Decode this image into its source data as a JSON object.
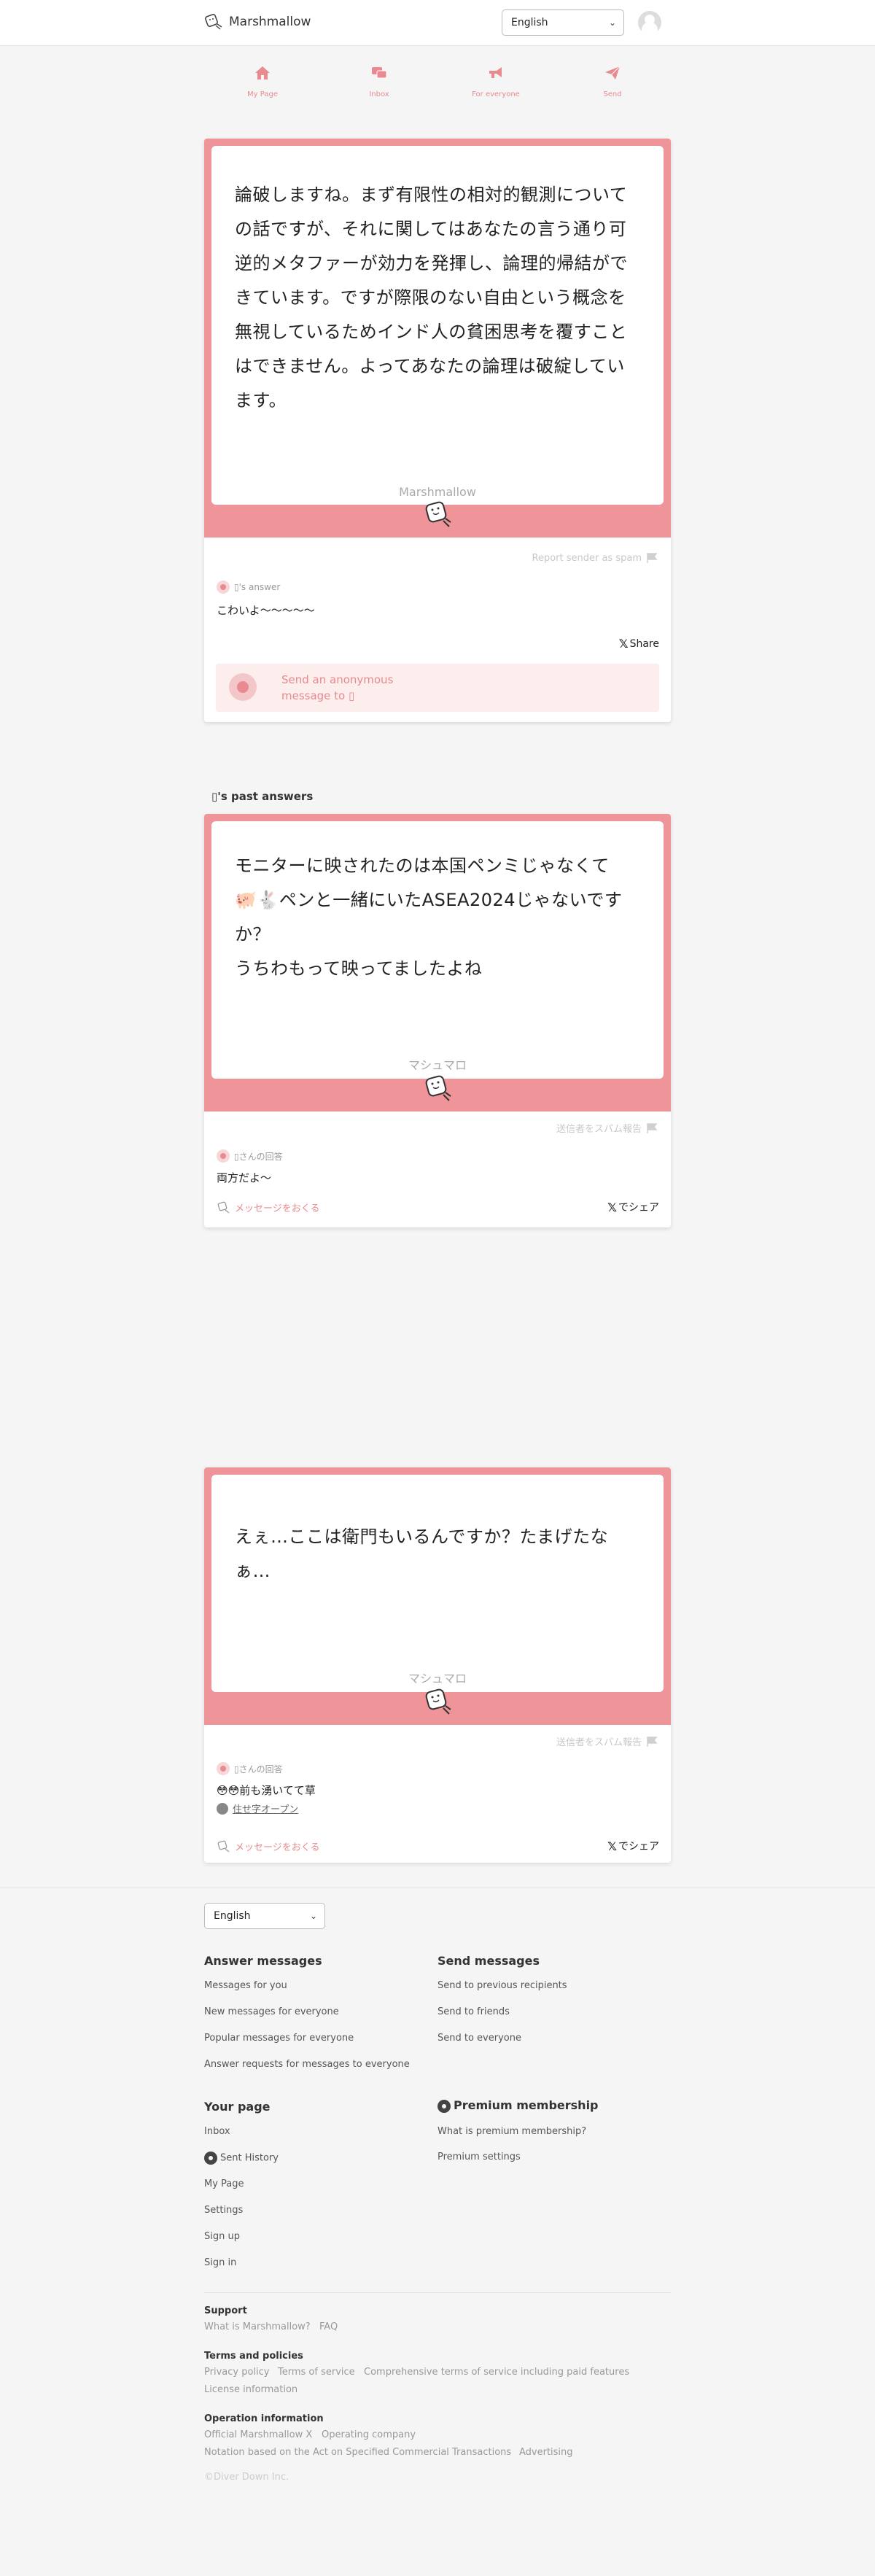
{
  "header": {
    "brand": "Marshmallow",
    "language": "English"
  },
  "nav": [
    {
      "label": "My Page",
      "icon": "home-icon"
    },
    {
      "label": "Inbox",
      "icon": "inbox-icon"
    },
    {
      "label": "For everyone",
      "icon": "megaphone-icon"
    },
    {
      "label": "Send",
      "icon": "paper-plane-icon"
    }
  ],
  "main_card": {
    "message": "論破しますね。まず有限性の相対的観測についての話ですが、それに関してはあなたの言う通り可逆的メタファーが効力を発揮し、論理的帰結ができています。ですが際限のない自由という概念を無視しているためインド人の貧困思考を覆すことはできません。よってあなたの論理は破綻しています。",
    "brand": "Marshmallow",
    "report": "Report sender as spam",
    "answer_label": "▯'s answer",
    "answer": "こわいよ〜〜〜〜〜",
    "share": "Share",
    "send_prompt": "Send an anonymous message to ▯"
  },
  "past_title": "▯'s past answers",
  "past": [
    {
      "message_lines": [
        "モニターに映されたのは本国ペンミじゃなくて",
        "🐖🐇ペンと一緒にいたASEA2024じゃないです",
        "か？",
        "うちわもって映ってましたよね"
      ],
      "brand": "マシュマロ",
      "report": "送信者をスパム報告",
      "answer_label": "▯さんの回答",
      "answer": "両方だよ〜",
      "send": "メッセージをおくる",
      "share": "でシェア"
    },
    {
      "message_lines": [
        "えぇ…ここは衛門もいるんですか？たまげたな",
        "ぁ…"
      ],
      "brand": "マシュマロ",
      "report": "送信者をスパム報告",
      "answer_label": "▯さんの回答",
      "answer": "😳😳前も湧いてて草",
      "answer_sub": "住せ字オープン",
      "send": "メッセージをおくる",
      "share": "でシェア"
    }
  ],
  "footer": {
    "language": "English",
    "answer_title": "Answer messages",
    "answer_links": [
      "Messages for you",
      "New messages for everyone",
      "Popular messages for everyone",
      "Answer requests for messages to everyone"
    ],
    "send_title": "Send messages",
    "send_links": [
      "Send to previous recipients",
      "Send to friends",
      "Send to everyone"
    ],
    "your_page_title": "Your page",
    "your_page_links": [
      "Inbox",
      "Sent History",
      "My Page",
      "Settings",
      "Sign up",
      "Sign in"
    ],
    "premium_title": "Premium membership",
    "premium_links": [
      "What is premium membership?",
      "Premium settings"
    ],
    "support_title": "Support",
    "support_links": [
      "What is Marshmallow?",
      "FAQ"
    ],
    "terms_title": "Terms and policies",
    "terms_links": [
      "Privacy policy",
      "Terms of service",
      "Comprehensive terms of service including paid features"
    ],
    "license": "License information",
    "operation_title": "Operation information",
    "operation_links": [
      "Official Marshmallow X",
      "Operating company"
    ],
    "operation_links2": [
      "Notation based on the Act on Specified Commercial Transactions",
      "Advertising"
    ],
    "copyright": "©Diver Down Inc."
  },
  "colors": {
    "accent": "#ef9499",
    "link_pink": "#e88a8f",
    "background": "#f5f5f5"
  }
}
